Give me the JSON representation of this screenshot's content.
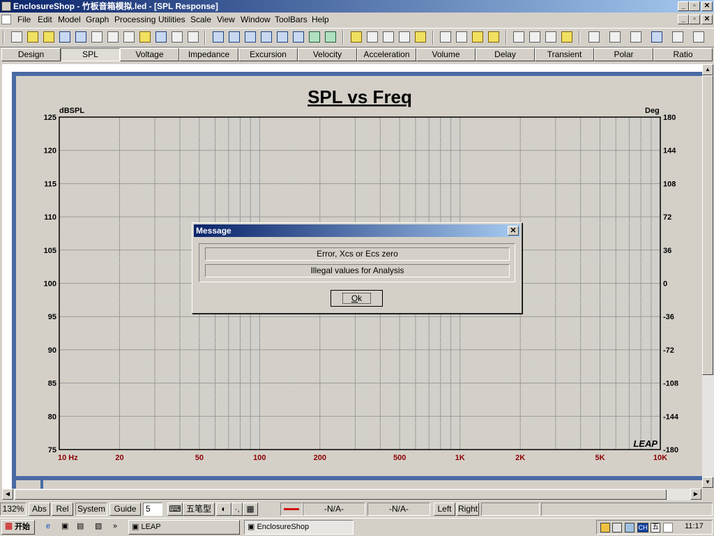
{
  "window": {
    "title": "EnclosureShop - 竹板音箱模拟.led - [SPL Response]",
    "controls": [
      "_",
      "▫",
      "✕"
    ],
    "doc_controls": [
      "_",
      "▫",
      "✕"
    ]
  },
  "menu": [
    "File",
    "Edit",
    "Model",
    "Graph",
    "Processing",
    "Utilities",
    "Scale",
    "View",
    "Window",
    "ToolBars",
    "Help"
  ],
  "tabs": [
    {
      "label": "Design",
      "active": false
    },
    {
      "label": "SPL",
      "active": true
    },
    {
      "label": "Voltage",
      "active": false
    },
    {
      "label": "Impedance",
      "active": false
    },
    {
      "label": "Excursion",
      "active": false
    },
    {
      "label": "Velocity",
      "active": false
    },
    {
      "label": "Acceleration",
      "active": false
    },
    {
      "label": "Volume",
      "active": false
    },
    {
      "label": "Delay",
      "active": false
    },
    {
      "label": "Transient",
      "active": false
    },
    {
      "label": "Polar",
      "active": false
    },
    {
      "label": "Ratio",
      "active": false
    }
  ],
  "chart_data": {
    "type": "line",
    "title": "SPL vs Freq",
    "ylabel_left": "dBSPL",
    "ylabel_right": "Deg",
    "xscale": "log",
    "xlim": [
      10,
      10000
    ],
    "x_ticks": [
      10,
      20,
      50,
      100,
      200,
      500,
      1000,
      2000,
      5000,
      10000
    ],
    "x_tick_labels": [
      "10  Hz",
      "20",
      "50",
      "100",
      "200",
      "500",
      "1K",
      "2K",
      "5K",
      "10K"
    ],
    "ylim_left": [
      75,
      125
    ],
    "y_ticks_left": [
      125,
      120,
      115,
      110,
      105,
      100,
      95,
      90,
      85,
      80,
      75
    ],
    "ylim_right": [
      -180,
      180
    ],
    "y_ticks_right": [
      180,
      144,
      108,
      72,
      36,
      0,
      -36,
      -72,
      -108,
      -144,
      -180
    ],
    "series": [],
    "grid": true,
    "watermark": "LEAP"
  },
  "dialog": {
    "title": "Message",
    "line1": "Error, Xcs or Ecs zero",
    "line2": "Illegal values for Analysis",
    "ok_label": "Ok",
    "close_label": "✕"
  },
  "status": {
    "zoom": "132%",
    "abs": "Abs",
    "rel": "Rel",
    "system": "System",
    "guide": "Guide",
    "guide_value": "5",
    "ime_label": "五笔型",
    "value1": "-N/A-",
    "value2": "-N/A-",
    "left": "Left",
    "right": "Right",
    "line_color": "#d01010"
  },
  "taskbar": {
    "start_label": "开始",
    "quicklaunch_more": "»",
    "task1": "LEAP",
    "task2": "EnclosureShop",
    "tray_ch": "CH",
    "tray_wu": "五",
    "clock": "11:17"
  },
  "colors": {
    "title_gradient_start": "#0a246a",
    "title_gradient_end": "#a6caf0",
    "frame_blue": "#4a6aa5",
    "tick_label_red": "#8b0000"
  }
}
